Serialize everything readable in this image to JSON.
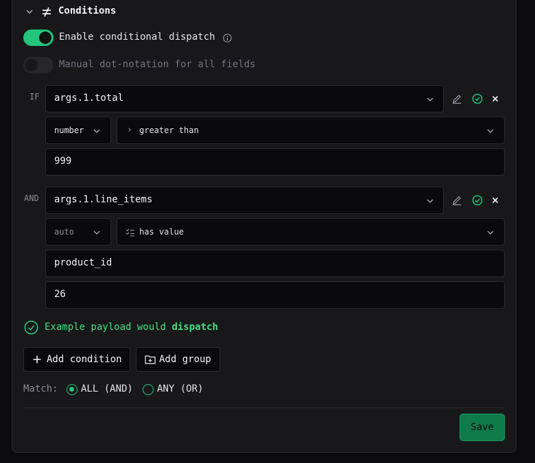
{
  "header": {
    "title": "Conditions",
    "collapse_icon": "chevron-down-icon",
    "section_icon": "not-equal-icon"
  },
  "toggles": {
    "enable_dispatch": {
      "label": "Enable conditional dispatch",
      "on": true
    },
    "manual_dot": {
      "label": "Manual dot-notation for all fields",
      "on": false
    }
  },
  "conditions": [
    {
      "keyword": "IF",
      "field": "args.1.total",
      "type": "number",
      "operator_symbol": "›",
      "operator": "greater than",
      "values": [
        "999"
      ]
    },
    {
      "keyword": "AND",
      "field": "args.1.line_items",
      "type": "auto",
      "operator_symbol": "list-check-icon",
      "operator": "has value",
      "values": [
        "product_id",
        "26"
      ]
    }
  ],
  "result": {
    "prefix": "Example payload would ",
    "outcome": "dispatch"
  },
  "buttons": {
    "add_condition": "Add condition",
    "add_group": "Add group",
    "save": "Save"
  },
  "match": {
    "label": "Match:",
    "options": [
      "ALL (AND)",
      "ANY (OR)"
    ],
    "selected": "ALL (AND)"
  },
  "colors": {
    "accent": "#22c57a",
    "save_bg": "#0f7a4a",
    "panel": "#18181b",
    "field_bg": "#0a0a0c"
  }
}
